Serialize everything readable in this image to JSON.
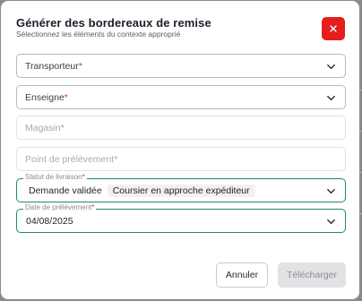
{
  "dialog": {
    "title": "Générer des bordereaux de remise",
    "subtitle": "Sélectionnez les éléments du contexte approprié",
    "close_icon": "close-icon"
  },
  "fields": {
    "transporteur": {
      "label": "Transporteur",
      "required_mark": "*"
    },
    "enseigne": {
      "label": "Enseigne",
      "required_mark": "*"
    },
    "magasin": {
      "label": "Magasin",
      "required_mark": "*"
    },
    "point_prelevement": {
      "label": "Point de prélèvement",
      "required_mark": "*"
    },
    "statut_livraison": {
      "label": "Statut de livraison",
      "required_mark": "*",
      "selected": [
        "Demande validée",
        "Coursier en approche expéditeur"
      ]
    },
    "date_prelevement": {
      "label": "Date de prélèvement",
      "required_mark": "*",
      "value": "04/08/2025"
    }
  },
  "actions": {
    "cancel_label": "Annuler",
    "download_label": "Télécharger"
  },
  "colors": {
    "accent": "#1e8a66",
    "danger": "#e51d1d",
    "required": "#d93030"
  }
}
